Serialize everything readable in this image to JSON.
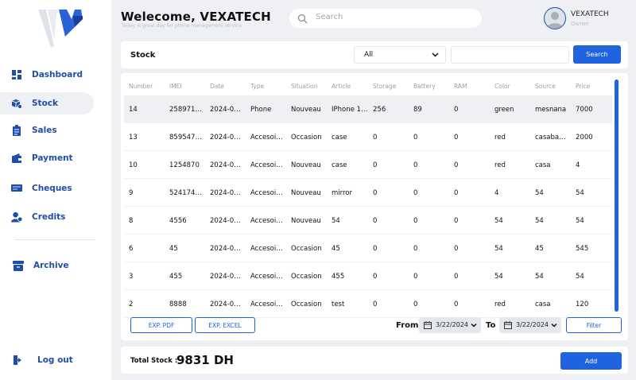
{
  "header": {
    "welcome": "Welecome, VEXATECH",
    "subtitle": "Today is great day for phone management service",
    "search_placeholder": "Search",
    "user_name": "VEXATECH",
    "user_role": "Owner"
  },
  "sidebar": {
    "items": [
      {
        "label": "Dashboard",
        "icon": "dashboard-icon"
      },
      {
        "label": "Stock",
        "icon": "boxes-icon"
      },
      {
        "label": "Sales",
        "icon": "clipboard-icon"
      },
      {
        "label": "Payment",
        "icon": "wallet-icon"
      },
      {
        "label": "Cheques",
        "icon": "cheque-icon"
      },
      {
        "label": "Credits",
        "icon": "credit-user-icon"
      },
      {
        "label": "Archive",
        "icon": "archive-icon"
      }
    ],
    "logout": "Log out",
    "active": "Stock"
  },
  "stock_bar": {
    "title": "Stock",
    "select_value": "All",
    "search_button": "Search"
  },
  "table": {
    "columns": [
      "Number",
      "IMEI",
      "Date",
      "Type",
      "Situation",
      "Article",
      "Storage",
      "Battery",
      "RAM",
      "Color",
      "Source",
      "Price"
    ],
    "rows": [
      [
        "14",
        "2589714…",
        "2024-0…",
        "Phone",
        "Nouveau",
        "IPhone 1…",
        "256",
        "89",
        "0",
        "green",
        "mesnana",
        "7000"
      ],
      [
        "13",
        "859547…",
        "2024-0…",
        "Accesoi…",
        "Occasion",
        "case",
        "0",
        "0",
        "0",
        "red",
        "casaba…",
        "2000"
      ],
      [
        "10",
        "1254870",
        "2024-0…",
        "Accesoi…",
        "Nouveau",
        "case",
        "0",
        "0",
        "0",
        "red",
        "casa",
        "4"
      ],
      [
        "9",
        "5241748…",
        "2024-0…",
        "Accesoi…",
        "Nouveau",
        "mirror",
        "0",
        "0",
        "0",
        "4",
        "54",
        "54"
      ],
      [
        "8",
        "4556",
        "2024-0…",
        "Accesoi…",
        "Nouveau",
        "54",
        "0",
        "0",
        "0",
        "54",
        "54",
        "54"
      ],
      [
        "6",
        "45",
        "2024-0…",
        "Accesoi…",
        "Occasion",
        "45",
        "0",
        "0",
        "0",
        "54",
        "45",
        "545"
      ],
      [
        "3",
        "455",
        "2024-0…",
        "Accesoi…",
        "Occasion",
        "455",
        "0",
        "0",
        "0",
        "54",
        "54",
        "54"
      ],
      [
        "2",
        "8888",
        "2024-0…",
        "Accesoi…",
        "Occasion",
        "test",
        "0",
        "0",
        "0",
        "red",
        "casa",
        "120"
      ]
    ],
    "selected_row": 0
  },
  "actions": {
    "exp_pdf": "EXP. PDF",
    "exp_excel": "EXP. EXCEL",
    "from_label": "From",
    "from_date": "3/22/2024",
    "to_label": "To",
    "to_date": "3/22/2024",
    "filter": "Filter"
  },
  "footer": {
    "total_label": "Total Stock :",
    "total_value": "9831 DH",
    "add_button": "Add"
  },
  "colors": {
    "accent": "#1f63e0",
    "nav_text": "#1f4ea8",
    "background": "#eef0f4"
  }
}
